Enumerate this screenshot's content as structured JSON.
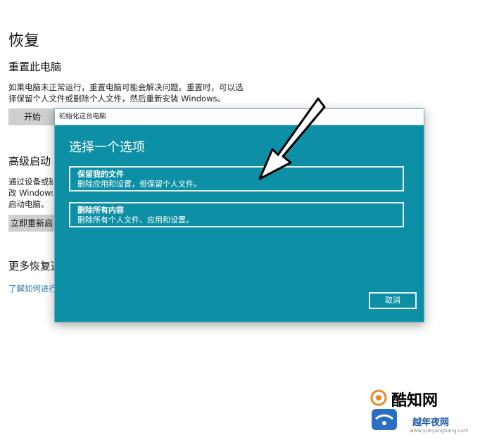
{
  "page": {
    "title": "恢复",
    "reset": {
      "heading": "重置此电脑",
      "desc_line1": "如果电脑未正常运行，重置电脑可能会解决问题。重置时，可以选",
      "desc_line2": "择保留个人文件或删除个人文件，然后重新安装 Windows。",
      "start_label": "开始"
    },
    "advanced": {
      "heading": "高级启动",
      "desc_line1": "通过设备或磁",
      "desc_line2": "改 Windows",
      "desc_line3": "启动电脑。",
      "restart_label": "立即重新启"
    },
    "more": {
      "heading": "更多恢复选",
      "link": "了解如何进行"
    }
  },
  "dialog": {
    "title": "初始化这台电脑",
    "heading": "选择一个选项",
    "options": [
      {
        "title": "保留我的文件",
        "desc": "删除应用和设置，但保留个人文件。"
      },
      {
        "title": "删除所有内容",
        "desc": "删除所有个人文件、应用和设置。"
      }
    ],
    "cancel_label": "取消"
  },
  "watermark": {
    "line1": "酷知网",
    "line2": "越年夜网",
    "line3": "www.yueyangbang.com"
  },
  "colors": {
    "dialog_bg": "#0d8fa6",
    "gray_button": "#cfcfcf",
    "link": "#2a7ab8"
  }
}
